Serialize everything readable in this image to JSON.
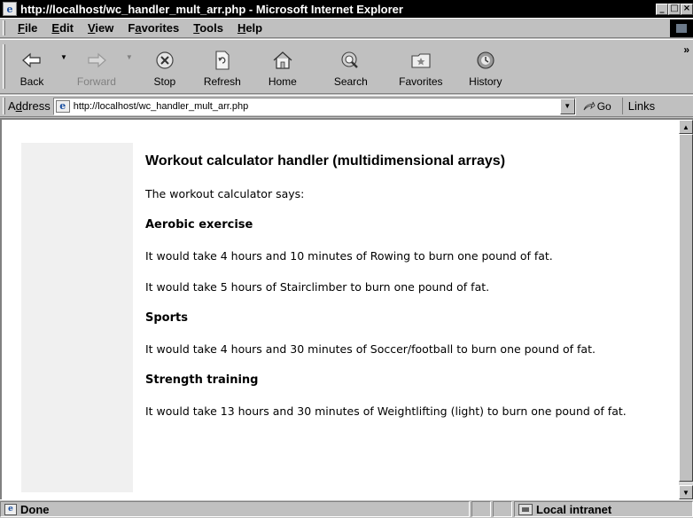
{
  "window": {
    "title": "http://localhost/wc_handler_mult_arr.php - Microsoft Internet Explorer",
    "minimize": "_",
    "maximize": "□",
    "close": "×"
  },
  "menu": {
    "items": [
      {
        "label": "File",
        "key": "F"
      },
      {
        "label": "Edit",
        "key": "E"
      },
      {
        "label": "View",
        "key": "V"
      },
      {
        "label": "Favorites",
        "key": "a"
      },
      {
        "label": "Tools",
        "key": "T"
      },
      {
        "label": "Help",
        "key": "H"
      }
    ],
    "file": "File",
    "edit": "Edit",
    "view": "View",
    "favorites": "Favorites",
    "tools": "Tools",
    "help": "Help"
  },
  "toolbar": {
    "back": "Back",
    "forward": "Forward",
    "stop": "Stop",
    "refresh": "Refresh",
    "home": "Home",
    "search": "Search",
    "favorites": "Favorites",
    "history": "History",
    "more": "»"
  },
  "address": {
    "label": "Address",
    "url": "http://localhost/wc_handler_mult_arr.php",
    "go": "Go",
    "links": "Links"
  },
  "page": {
    "heading": "Workout calculator handler (multidimensional arrays)",
    "intro": "The workout calculator says:",
    "sections": [
      {
        "title": "Aerobic exercise",
        "lines": [
          "It would take 4 hours and 10 minutes of Rowing to burn one pound of fat.",
          "It would take 5 hours of Stairclimber to burn one pound of fat."
        ]
      },
      {
        "title": "Sports",
        "lines": [
          "It would take 4 hours and 30 minutes of Soccer/football to burn one pound of fat."
        ]
      },
      {
        "title": "Strength training",
        "lines": [
          "It would take 13 hours and 30 minutes of Weightlifting (light) to burn one pound of fat."
        ]
      }
    ]
  },
  "status": {
    "text": "Done",
    "zone": "Local intranet"
  },
  "icons": {
    "ie": "e",
    "page": "e"
  }
}
